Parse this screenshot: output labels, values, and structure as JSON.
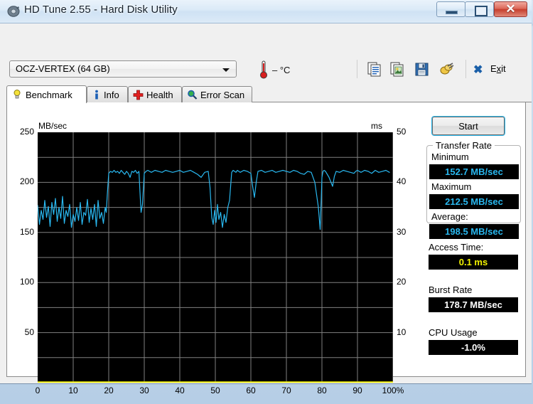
{
  "window": {
    "title": "HD Tune 2.55 - Hard Disk Utility",
    "icon": "hdd-icon",
    "minimize_label": "Minimize",
    "maximize_label": "Maximize",
    "close_label": "✕"
  },
  "toolbar": {
    "drive": {
      "selected": "OCZ-VERTEX (64 GB)",
      "options": [
        "OCZ-VERTEX (64 GB)"
      ]
    },
    "temperature": "–  °C",
    "buttons": [
      {
        "name": "copy-icon",
        "label": "Copy"
      },
      {
        "name": "screenshot-icon",
        "label": "Screenshot"
      },
      {
        "name": "save-icon",
        "label": "Save"
      },
      {
        "name": "settings-icon",
        "label": "Options"
      }
    ],
    "exit_label_pre": "E",
    "exit_label_accel": "x",
    "exit_label_post": "it",
    "exit_label": "Exit"
  },
  "tabs": [
    {
      "id": "benchmark",
      "label": "Benchmark",
      "icon": "bulb-icon",
      "active": true
    },
    {
      "id": "info",
      "label": "Info",
      "icon": "info-icon",
      "active": false
    },
    {
      "id": "health",
      "label": "Health",
      "icon": "cross-icon",
      "active": false
    },
    {
      "id": "errorscan",
      "label": "Error Scan",
      "icon": "magnifier-icon",
      "active": false
    }
  ],
  "results": {
    "start_label": "Start",
    "transfer_rate": {
      "group_title": "Transfer Rate",
      "minimum_label": "Minimum",
      "minimum_value": "152.7 MB/sec",
      "maximum_label": "Maximum",
      "maximum_value": "212.5 MB/sec",
      "average_label": "Average:",
      "average_value": "198.5 MB/sec"
    },
    "access_time": {
      "label": "Access Time:",
      "value": "0.1 ms"
    },
    "burst_rate": {
      "label": "Burst Rate",
      "value": "178.7 MB/sec"
    },
    "cpu_usage": {
      "label": "CPU Usage",
      "value": "-1.0%"
    }
  },
  "chart_data": {
    "type": "line",
    "title": "",
    "xlabel": "",
    "ylabel": "MB/sec",
    "y2label": "ms",
    "xlim": [
      0,
      100
    ],
    "ylim": [
      0,
      250
    ],
    "y2lim": [
      0,
      50
    ],
    "yticks": [
      50,
      100,
      150,
      200,
      250
    ],
    "y2ticks": [
      10,
      20,
      30,
      40,
      50
    ],
    "xticks": [
      0,
      10,
      20,
      30,
      40,
      50,
      60,
      70,
      80,
      90,
      100
    ],
    "xticklabels": [
      "0",
      "10",
      "20",
      "30",
      "40",
      "50",
      "60",
      "70",
      "80",
      "90",
      "100%"
    ],
    "grid": true,
    "background": "#000000",
    "series": [
      {
        "name": "Transfer rate",
        "color": "#29b8f0",
        "axis": "left",
        "unit": "MB/sec",
        "x": [
          0.0,
          0.5,
          1.0,
          1.5,
          2.0,
          2.5,
          3.0,
          3.5,
          4.0,
          4.5,
          5.0,
          5.5,
          6.0,
          6.5,
          7.0,
          7.5,
          8.0,
          8.5,
          9.0,
          9.5,
          10.0,
          10.5,
          11.0,
          11.5,
          12.0,
          12.5,
          13.0,
          13.5,
          14.0,
          14.5,
          15.0,
          15.5,
          16.0,
          16.5,
          17.0,
          17.5,
          18.0,
          18.5,
          19.0,
          19.3,
          19.6,
          20.0,
          20.5,
          21.0,
          21.5,
          22.0,
          22.5,
          23.0,
          23.5,
          24.0,
          24.5,
          25.0,
          25.5,
          26.0,
          26.5,
          27.0,
          27.5,
          28.0,
          28.5,
          28.8,
          29.1,
          29.5,
          30.0,
          30.5,
          31.0,
          31.5,
          32.0,
          33.0,
          34.0,
          35.0,
          36.0,
          37.0,
          38.0,
          39.0,
          40.0,
          41.0,
          42.0,
          43.0,
          44.0,
          45.0,
          46.0,
          47.0,
          48.0,
          48.5,
          49.0,
          49.4,
          49.8,
          50.2,
          50.6,
          51.0,
          51.5,
          52.0,
          52.5,
          53.0,
          53.5,
          54.0,
          54.3,
          54.6,
          55.0,
          55.4,
          55.8,
          56.2,
          56.6,
          57.0,
          58.0,
          59.0,
          60.0,
          60.5,
          61.0,
          61.5,
          62.0,
          63.0,
          64.0,
          65.0,
          66.0,
          67.0,
          68.0,
          69.0,
          70.0,
          71.0,
          72.0,
          73.0,
          74.0,
          75.0,
          76.0,
          77.0,
          78.0,
          79.0,
          79.5,
          79.8,
          80.0,
          80.3,
          80.6,
          81.0,
          82.0,
          83.0,
          83.5,
          84.0,
          85.0,
          86.0,
          87.0,
          88.0,
          89.0,
          89.5,
          90.0,
          91.0,
          92.0,
          93.0,
          94.0,
          95.0,
          96.0,
          97.0,
          98.0,
          99.0,
          100.0
        ],
        "y": [
          177,
          158,
          172,
          163,
          182,
          165,
          176,
          156,
          180,
          168,
          184,
          161,
          175,
          164,
          186,
          159,
          172,
          166,
          178,
          155,
          168,
          161,
          175,
          162,
          180,
          158,
          170,
          167,
          183,
          160,
          174,
          163,
          178,
          156,
          182,
          164,
          170,
          159,
          175,
          170,
          188,
          209,
          211,
          210,
          212,
          210,
          211,
          209,
          212,
          210,
          208,
          211,
          209,
          205,
          211,
          210,
          212,
          209,
          211,
          190,
          170,
          178,
          209,
          211,
          212,
          211,
          210,
          212,
          211,
          210,
          212,
          211,
          210,
          211,
          212,
          210,
          211,
          212,
          210,
          208,
          205,
          210,
          211,
          195,
          165,
          158,
          172,
          160,
          178,
          163,
          170,
          155,
          168,
          160,
          175,
          182,
          196,
          210,
          212,
          211,
          210,
          212,
          211,
          210,
          212,
          211,
          209,
          196,
          185,
          200,
          211,
          212,
          210,
          211,
          212,
          210,
          211,
          212,
          211,
          210,
          212,
          211,
          209,
          208,
          211,
          210,
          200,
          175,
          153,
          182,
          205,
          211,
          212,
          211,
          205,
          196,
          206,
          211,
          210,
          212,
          211,
          210,
          209,
          211,
          212,
          210,
          212,
          211,
          209,
          212,
          210,
          211,
          212,
          210
        ]
      },
      {
        "name": "Access time",
        "color": "#f2f200",
        "axis": "right",
        "unit": "ms",
        "x": [
          0,
          5,
          10,
          15,
          20,
          25,
          30,
          35,
          40,
          45,
          50,
          55,
          60,
          65,
          70,
          75,
          80,
          85,
          90,
          95,
          100
        ],
        "y": [
          0.1,
          0.1,
          0.1,
          0.1,
          0.1,
          0.1,
          0.1,
          0.1,
          0.1,
          0.1,
          0.1,
          0.1,
          0.1,
          0.1,
          0.1,
          0.1,
          0.1,
          0.1,
          0.1,
          0.1,
          0.1
        ]
      }
    ]
  }
}
